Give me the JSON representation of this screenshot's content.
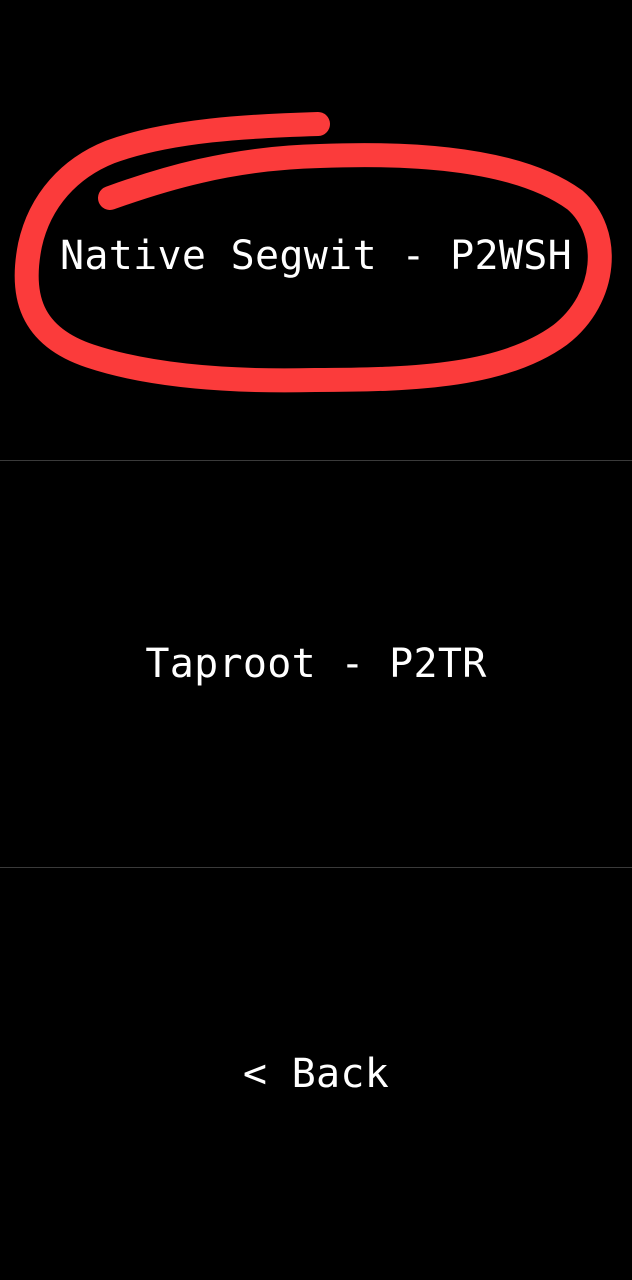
{
  "menu": {
    "items": [
      {
        "label": "Native Segwit - P2WSH"
      },
      {
        "label": "Taproot - P2TR"
      },
      {
        "label": "< Back"
      }
    ]
  },
  "annotation": {
    "type": "hand-drawn circle",
    "color": "#fb3b3b"
  }
}
